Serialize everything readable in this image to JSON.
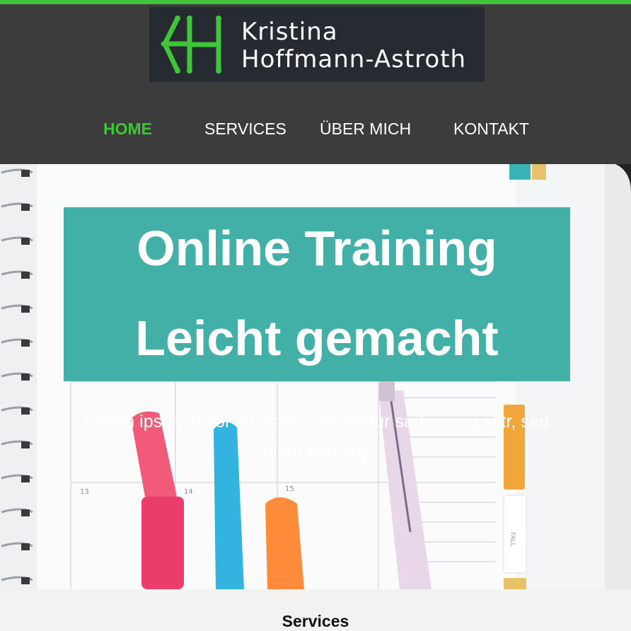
{
  "brand": {
    "accent": "#3fc43a",
    "teal": "#42b0a6",
    "logo_mark": "KH",
    "name_line1": "Kristina",
    "name_line2": "Hoffmann-Astroth"
  },
  "nav": {
    "items": [
      {
        "label": "HOME",
        "active": true
      },
      {
        "label": "SERVICES",
        "active": false
      },
      {
        "label": "ÜBER MICH",
        "active": false
      },
      {
        "label": "KONTAKT",
        "active": false
      }
    ]
  },
  "hero": {
    "title_line1": "Online Training",
    "title_line2": "Leicht gemacht",
    "subtitle": "Lorem ipsum dolor sit amet, consetetur sadipscing elitr, sed diam nonumy",
    "calendar_numbers": [
      "13",
      "14",
      "15"
    ],
    "tab_label": "FALL"
  },
  "services": {
    "heading": "Services"
  }
}
